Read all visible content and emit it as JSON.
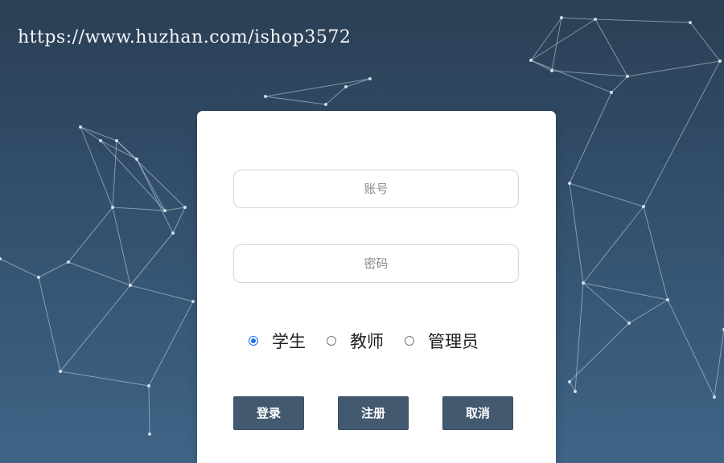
{
  "watermark": {
    "url_text": "https://www.huzhan.com/ishop3572"
  },
  "login_form": {
    "account_placeholder": "账号",
    "password_placeholder": "密码",
    "roles": [
      {
        "label": "学生",
        "selected": true
      },
      {
        "label": "教师",
        "selected": false
      },
      {
        "label": "管理员",
        "selected": false
      }
    ],
    "buttons": {
      "login_label": "登录",
      "register_label": "注册",
      "cancel_label": "取消"
    }
  },
  "colors": {
    "background_top": "#2b3f55",
    "background_bottom": "#3f6486",
    "button": "#435970",
    "radio_selected": "#1a73e8"
  }
}
